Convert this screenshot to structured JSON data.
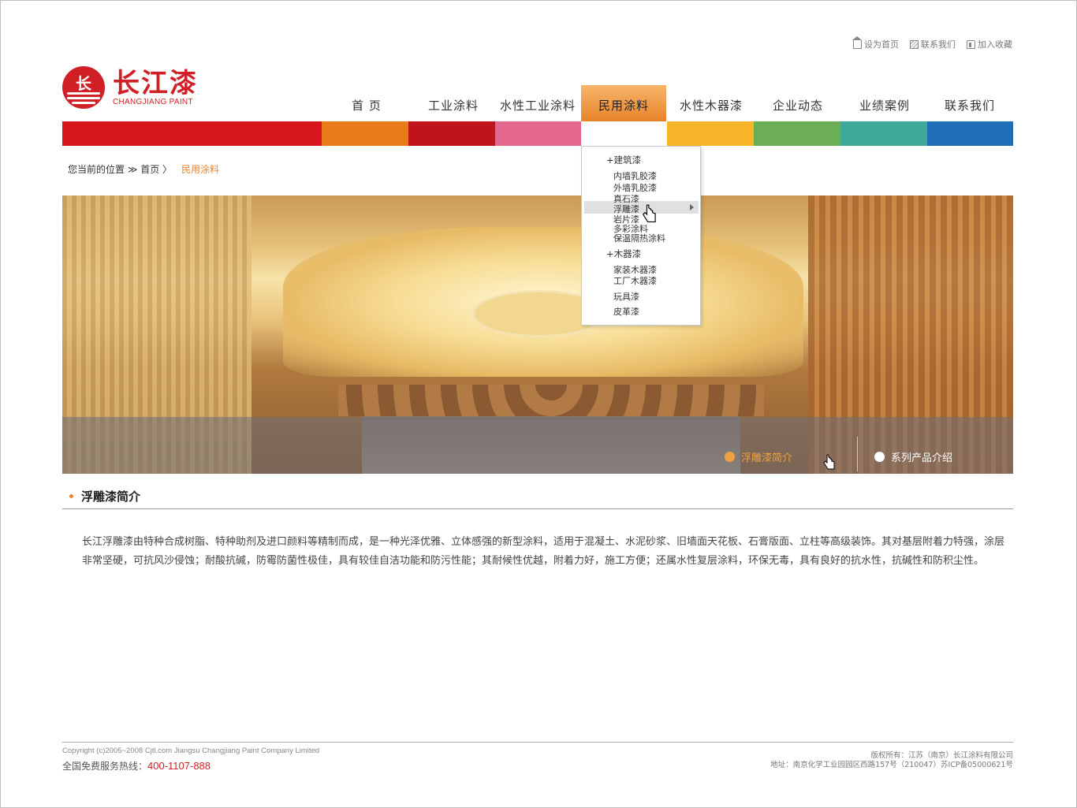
{
  "util_links": [
    "设为首页",
    "联系我们",
    "加入收藏"
  ],
  "logo": {
    "cn": "长江漆",
    "en": "CHANGJIANG PAINT"
  },
  "nav": [
    "首 页",
    "工业涂料",
    "水性工业涂料",
    "民用涂料",
    "水性木器漆",
    "企业动态",
    "业绩案例",
    "联系我们"
  ],
  "nav_active_index": 3,
  "color_bar": [
    "#d7161e",
    "#e97b18",
    "#c0141c",
    "#e4688e",
    "#f7b52a",
    "#6cae55",
    "#3ea899",
    "#1f6db5"
  ],
  "breadcrumb": {
    "label": "您当前的位置 ≫ 首页 〉",
    "current": "民用涂料"
  },
  "dropdown": {
    "groups": [
      {
        "title": "+建筑漆",
        "items": [
          "内墙乳胶漆",
          "外墙乳胶漆",
          "真石漆",
          "浮雕漆",
          "岩片漆",
          "多彩涂料",
          "保温隔热涂料"
        ]
      },
      {
        "title": "+木器漆",
        "items": [
          "家装木器漆",
          "工厂木器漆"
        ]
      },
      {
        "title": "",
        "items": [
          "玩具漆",
          "皮革漆"
        ]
      }
    ],
    "highlighted": "浮雕漆"
  },
  "banner": {
    "tab_active": "浮雕漆简介",
    "tab_other": "系列产品介绍"
  },
  "section": {
    "title": "浮雕漆简介",
    "description": "长江浮雕漆由特种合成树脂、特种助剂及进口颜料等精制而成，是一种光泽优雅、立体感强的新型涂料，适用于混凝土、水泥砂浆、旧墙面天花板、石膏版面、立柱等高级装饰。其对基层附着力特强，涂层非常坚硬，可抗风沙侵蚀；耐酸抗碱，防霉防菌性极佳，具有较佳自洁功能和防污性能；其耐候性优越，附着力好，施工方便；还属水性复层涂料，环保无毒，具有良好的抗水性，抗碱性和防积尘性。"
  },
  "footer": {
    "copyright": "Copyright (c)2005~2008 Cjtl.com Jiangsu Changjiang Paint Company Limited",
    "hotline_label": "全国免费服务热线：",
    "hotline_number": "400-1107-888",
    "rights": "版权所有：江苏（南京）长江涂料有限公司",
    "address": "地址：南京化学工业园园区西路157号（210047）苏ICP备05000621号"
  }
}
